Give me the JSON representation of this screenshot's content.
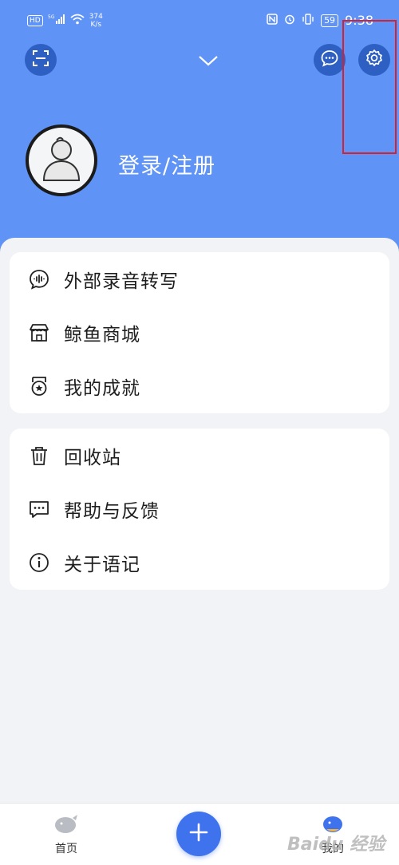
{
  "status_bar": {
    "hd": "HD",
    "signal": "5G",
    "net_speed_value": "374",
    "net_speed_unit": "K/s",
    "battery": "59",
    "time": "9:38"
  },
  "header": {
    "login_label": "登录/注册"
  },
  "menu_group_1": [
    {
      "label": "外部录音转写",
      "icon": "audio-transcribe-icon"
    },
    {
      "label": "鲸鱼商城",
      "icon": "store-icon"
    },
    {
      "label": "我的成就",
      "icon": "medal-icon"
    }
  ],
  "menu_group_2": [
    {
      "label": "回收站",
      "icon": "trash-icon"
    },
    {
      "label": "帮助与反馈",
      "icon": "feedback-icon"
    },
    {
      "label": "关于语记",
      "icon": "info-icon"
    }
  ],
  "tabbar": {
    "home_label": "首页",
    "mine_label": "我的"
  },
  "watermark": "Baidu 经验",
  "colors": {
    "header_bg": "#5f93f5",
    "header_button_bg": "#2e5fc2",
    "fab": "#3f73ee",
    "highlight": "#d9202e"
  }
}
